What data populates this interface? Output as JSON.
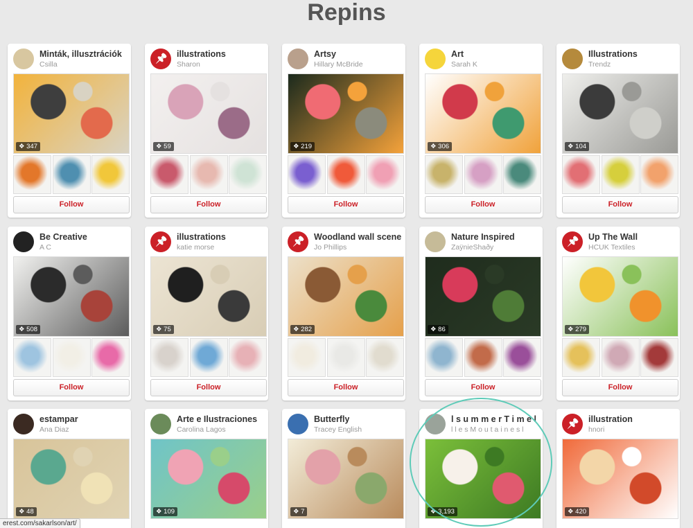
{
  "page_title": "Repins",
  "status_url": "erest.com/sakarlson/art/",
  "follow_label": "Follow",
  "cards": [
    {
      "title": "Minták, illusztrációk",
      "owner": "Csilla",
      "count": "347",
      "avatar": "photo",
      "avatar_color": "#d8c7a0",
      "cover_colors": [
        "#f2b33c",
        "#3e3e3e",
        "#e36a4c",
        "#d9d3c3"
      ],
      "thumb_colors": [
        "#e3772a",
        "#4f8fb0",
        "#f1c73a"
      ]
    },
    {
      "title": "illustrations",
      "owner": "Sharon",
      "count": "59",
      "avatar": "pin",
      "cover_colors": [
        "#f3f0ef",
        "#d9a3b8",
        "#9b6c88",
        "#e5e1e0"
      ],
      "thumb_colors": [
        "#c95a6c",
        "#e7b9b0",
        "#cfe3d5"
      ]
    },
    {
      "title": "Artsy",
      "owner": "Hillary McBride",
      "count": "219",
      "avatar": "photo",
      "avatar_color": "#b9a08c",
      "cover_colors": [
        "#1b2a1d",
        "#f06b73",
        "#8b8b7c",
        "#f4a23b"
      ],
      "thumb_colors": [
        "#7a5fd0",
        "#f05a3a",
        "#f0a0b4"
      ]
    },
    {
      "title": "Art",
      "owner": "Sarah K",
      "count": "306",
      "avatar": "photo",
      "avatar_color": "#f5d53b",
      "cover_colors": [
        "#ffffff",
        "#d13a4b",
        "#3f9a6f",
        "#f0a23b"
      ],
      "thumb_colors": [
        "#c8b36b",
        "#d6a0c4",
        "#4a8a7c"
      ]
    },
    {
      "title": "Illustrations",
      "owner": "Trendz",
      "count": "104",
      "avatar": "photo",
      "avatar_color": "#b58a3c",
      "cover_colors": [
        "#efefec",
        "#3b3b3b",
        "#cfcfca",
        "#9a9a96"
      ],
      "thumb_colors": [
        "#e26f74",
        "#d6cf3c",
        "#f2a26c"
      ]
    },
    {
      "title": "Be Creative",
      "owner": "A C",
      "count": "508",
      "avatar": "photo",
      "avatar_color": "#222222",
      "cover_colors": [
        "#f1f1ef",
        "#2b2b2b",
        "#a8433a",
        "#5c5c5c"
      ],
      "thumb_colors": [
        "#9ec4e0",
        "#f2efe6",
        "#e86aa8"
      ]
    },
    {
      "title": "illustrations",
      "owner": "katie morse",
      "count": "75",
      "avatar": "pin",
      "cover_colors": [
        "#ece4d3",
        "#1f1f1f",
        "#3a3a3a",
        "#d8cdb5"
      ],
      "thumb_colors": [
        "#d8d2cc",
        "#6fa9d6",
        "#e7b1b6"
      ]
    },
    {
      "title": "Woodland wall scene",
      "owner": "Jo Phillips",
      "count": "282",
      "avatar": "pin",
      "cover_colors": [
        "#ece0c9",
        "#8a5a35",
        "#4a8a3c",
        "#e5a04b"
      ],
      "thumb_colors": [
        "#f1ece0",
        "#e9e9e6",
        "#e1dccf"
      ]
    },
    {
      "title": "Nature Inspired",
      "owner": "ZaÿnieShaðy",
      "count": "86",
      "avatar": "photo",
      "avatar_color": "#c6bb98",
      "cover_colors": [
        "#1f2c1d",
        "#d83b5a",
        "#4f7c37",
        "#2a3a26"
      ],
      "thumb_colors": [
        "#8fb5cf",
        "#c26b4a",
        "#9a4f9a"
      ]
    },
    {
      "title": "Up The Wall",
      "owner": "HCUK Textiles",
      "count": "279",
      "avatar": "pin",
      "cover_colors": [
        "#ffffff",
        "#f2c63b",
        "#f0922c",
        "#8ac15a"
      ],
      "thumb_colors": [
        "#e5c15b",
        "#d0a9b5",
        "#a33a3a"
      ]
    },
    {
      "title": "estampar",
      "owner": "Ana Diaz",
      "count": "48",
      "avatar": "photo",
      "avatar_color": "#3b2a22",
      "cover_colors": [
        "#d8c49a",
        "#5aa88f",
        "#f0e2b6",
        "#e0d3b3"
      ],
      "thumb_colors": []
    },
    {
      "title": "Arte e Ilustraciones",
      "owner": "Carolina Lagos",
      "count": "109",
      "avatar": "photo",
      "avatar_color": "#6b8b5a",
      "cover_colors": [
        "#6fc4c8",
        "#f0a3b4",
        "#d64a6a",
        "#9acf8a"
      ],
      "thumb_colors": []
    },
    {
      "title": "Butterfly",
      "owner": "Tracey English",
      "count": "7",
      "avatar": "photo",
      "avatar_color": "#3a6fb0",
      "cover_colors": [
        "#f2ecd8",
        "#e3a1a9",
        "#8aa86c",
        "#b98b5c"
      ],
      "thumb_colors": []
    },
    {
      "title": "l s u m m e r T i m e l",
      "owner": "l l e s M o u t a i n e s l",
      "count": "3,193",
      "avatar": "photo",
      "avatar_color": "#9aa39a",
      "cover_colors": [
        "#7bbf3a",
        "#f7f1ea",
        "#e05a6f",
        "#3d7a23"
      ],
      "thumb_colors": []
    },
    {
      "title": "illustration",
      "owner": "hnori",
      "count": "420",
      "avatar": "pin",
      "cover_colors": [
        "#f06a3a",
        "#f3d6a8",
        "#d24a2a",
        "#ffffff"
      ],
      "thumb_colors": []
    }
  ]
}
